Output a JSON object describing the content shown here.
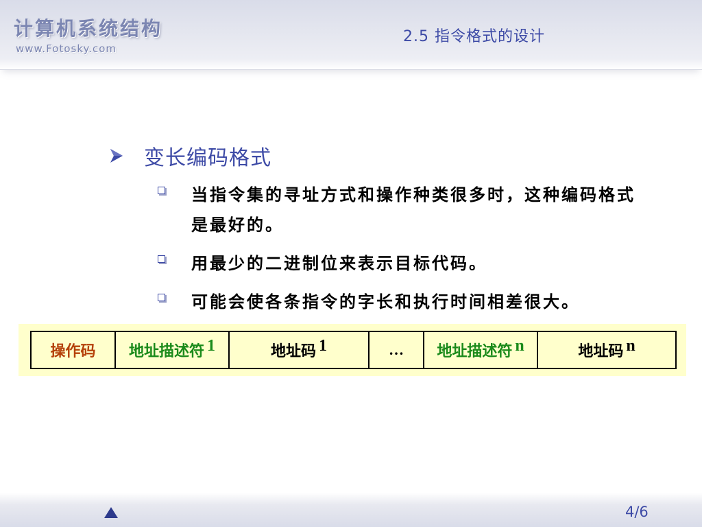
{
  "header": {
    "course_title": "计算机系统结构",
    "course_url": "www.Fotosky.com",
    "section_title": "2.5  指令格式的设计"
  },
  "main": {
    "heading": "变长编码格式",
    "bullets": [
      "当指令集的寻址方式和操作种类很多时，这种编码格式是最好的。",
      "用最少的二进制位来表示目标代码。",
      "可能会使各条指令的字长和执行时间相差很大。"
    ]
  },
  "format_diagram": {
    "cells": [
      {
        "label": "操作码",
        "suffix": ""
      },
      {
        "label": "地址描述符",
        "suffix": "1"
      },
      {
        "label": "地址码",
        "suffix": "1"
      },
      {
        "label": "…",
        "suffix": ""
      },
      {
        "label": "地址描述符",
        "suffix": "n"
      },
      {
        "label": "地址码",
        "suffix": "n"
      }
    ]
  },
  "footer": {
    "page_number": "4/6"
  },
  "colors": {
    "accent_blue": "#3d4aa6",
    "header_logo": "#7c86b2",
    "opcode": "#b5410a",
    "descriptor": "#1a8a1a",
    "diagram_bg": "#ffffcc"
  },
  "icons": {
    "heading_bullet": "arrowhead-icon",
    "item_bullet": "square-bullet-icon",
    "nav": "triangle-up-icon"
  }
}
